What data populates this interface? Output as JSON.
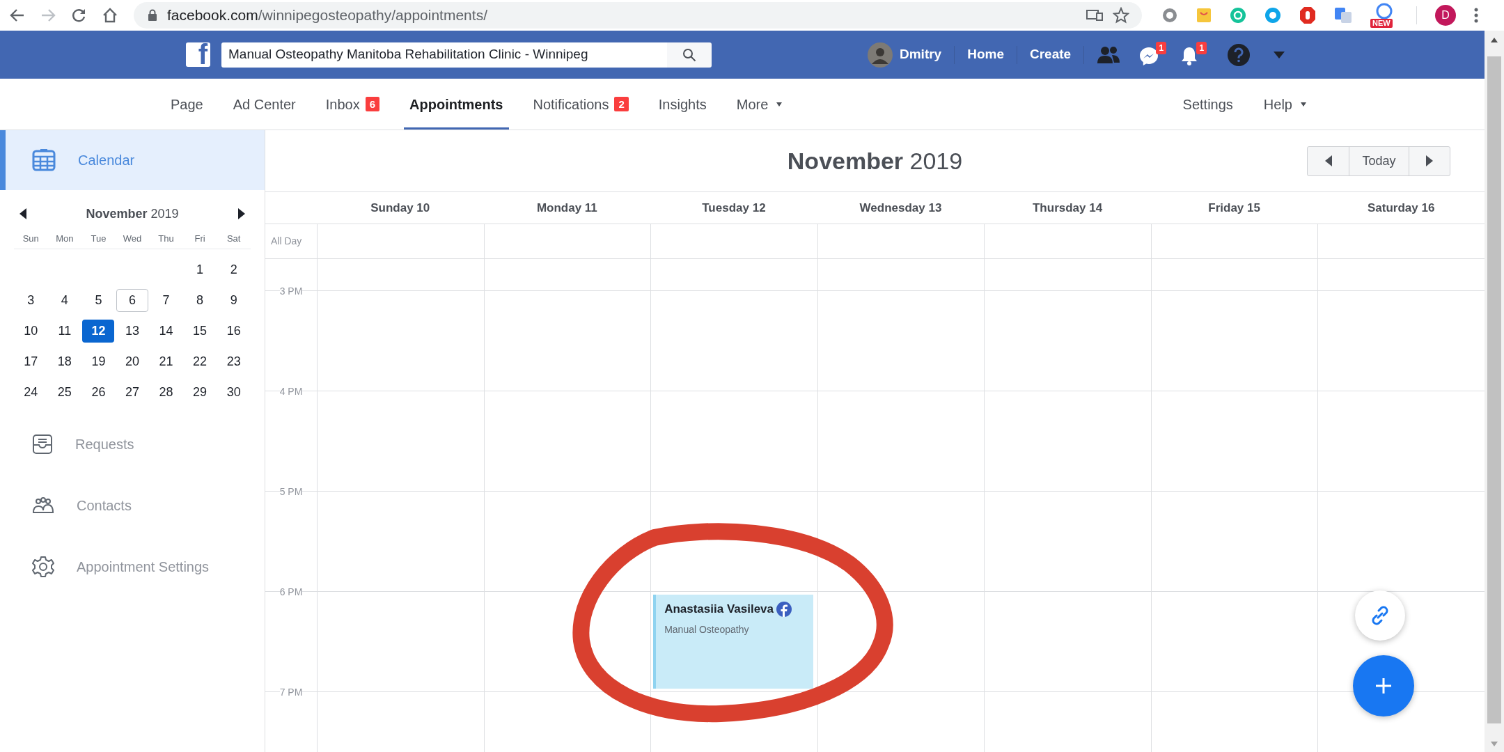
{
  "browser": {
    "url_domain": "facebook.com",
    "url_path": "/winnipegosteopathy/appointments/",
    "extension_badge": "NEW",
    "profile_initial": "D"
  },
  "header": {
    "logo": "f",
    "search": {
      "value": "Manual Osteopathy Manitoba Rehabilitation Clinic - Winnipeg"
    },
    "user": "Dmitry",
    "links": [
      "Home",
      "Create"
    ],
    "messenger_badge": "1",
    "notifications_badge": "1"
  },
  "subnav": {
    "tabs": [
      {
        "label": "Page",
        "dropdown": false,
        "selected": false
      },
      {
        "label": "Ad Center",
        "dropdown": false,
        "selected": false
      },
      {
        "label": "Inbox",
        "badge": "6",
        "dropdown": false,
        "selected": false
      },
      {
        "label": "Appointments",
        "dropdown": false,
        "selected": true
      },
      {
        "label": "Notifications",
        "badge": "2",
        "dropdown": false,
        "selected": false
      },
      {
        "label": "Insights",
        "dropdown": false,
        "selected": false
      },
      {
        "label": "More",
        "dropdown": true,
        "selected": false
      }
    ],
    "right_links": [
      {
        "label": "Settings",
        "dropdown": false
      },
      {
        "label": "Help",
        "dropdown": true
      }
    ]
  },
  "sidebar": {
    "items": [
      {
        "label": "Calendar",
        "selected": true
      },
      {
        "label": "Requests",
        "selected": false
      },
      {
        "label": "Contacts",
        "selected": false
      },
      {
        "label": "Appointment Settings",
        "selected": false
      }
    ]
  },
  "mini_calendar": {
    "title": "**November** 2019",
    "weekdays": [
      "Sun",
      "Mon",
      "Tue",
      "Wed",
      "Thu",
      "Fri",
      "Sat"
    ],
    "weeks": [
      [
        {
          "day": "1",
          "selected": false,
          "today": false
        },
        {
          "day": "2",
          "selected": false,
          "today": false
        }
      ],
      [
        {
          "day": "3",
          "selected": false,
          "today": false
        },
        {
          "day": "4",
          "selected": false,
          "today": false
        },
        {
          "day": "5",
          "selected": false,
          "today": false
        },
        {
          "day": "6",
          "selected": false,
          "today": true
        },
        {
          "day": "7",
          "selected": false,
          "today": false
        },
        {
          "day": "8",
          "selected": false,
          "today": false
        },
        {
          "day": "9",
          "selected": false,
          "today": false
        }
      ],
      [
        {
          "day": "10",
          "selected": false,
          "today": false
        },
        {
          "day": "11",
          "selected": false,
          "today": false
        },
        {
          "day": "12",
          "selected": true,
          "today": false
        },
        {
          "day": "13",
          "selected": false,
          "today": false
        },
        {
          "day": "14",
          "selected": false,
          "today": false
        },
        {
          "day": "15",
          "selected": false,
          "today": false
        },
        {
          "day": "16",
          "selected": false,
          "today": false
        }
      ],
      [
        {
          "day": "17",
          "selected": false,
          "today": false
        },
        {
          "day": "18",
          "selected": false,
          "today": false
        },
        {
          "day": "19",
          "selected": false,
          "today": false
        },
        {
          "day": "20",
          "selected": false,
          "today": false
        },
        {
          "day": "21",
          "selected": false,
          "today": false
        },
        {
          "day": "22",
          "selected": false,
          "today": false
        },
        {
          "day": "23",
          "selected": false,
          "today": false
        }
      ],
      [
        {
          "day": "24",
          "selected": false,
          "today": false
        },
        {
          "day": "25",
          "selected": false,
          "today": false
        },
        {
          "day": "26",
          "selected": false,
          "today": false
        },
        {
          "day": "27",
          "selected": false,
          "today": false
        },
        {
          "day": "28",
          "selected": false,
          "today": false
        },
        {
          "day": "29",
          "selected": false,
          "today": false
        },
        {
          "day": "30",
          "selected": false,
          "today": false
        }
      ]
    ]
  },
  "calendar": {
    "title": "**November** 2019",
    "today_button": "Today",
    "all_day_label": "All Day",
    "days": [
      {
        "label": "Sunday 10"
      },
      {
        "label": "Monday 11"
      },
      {
        "label": "Tuesday 12",
        "events": [
          {
            "title": "Anastasiia Vasileva",
            "subtitle": "Manual Osteopathy"
          }
        ]
      },
      {
        "label": "Wednesday 13"
      },
      {
        "label": "Thursday 14"
      },
      {
        "label": "Friday 15"
      },
      {
        "label": "Saturday 16"
      }
    ],
    "hours": [
      "3 PM",
      "4 PM",
      "5 PM",
      "6 PM",
      "7 PM"
    ]
  }
}
